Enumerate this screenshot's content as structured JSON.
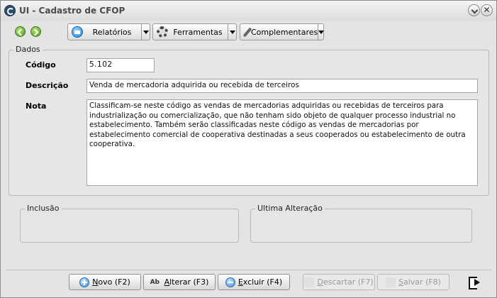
{
  "window": {
    "title": "UI - Cadastro de CFOP"
  },
  "toolbar": {
    "relatorios_label": "Relatórios",
    "ferramentas_label": "Ferramentas",
    "complementares_label": "Complementares"
  },
  "dados": {
    "group_title": "Dados",
    "codigo_label": "Código",
    "codigo_value": "5.102",
    "descricao_label": "Descrição",
    "descricao_value": "Venda de mercadoria adquirida ou recebida de terceiros",
    "nota_label": "Nota",
    "nota_value": "Classificam-se neste código as vendas de mercadorias adquiridas ou recebidas de terceiros para industrialização ou comercialização, que não tenham sido objeto de qualquer processo industrial no estabelecimento. Também serão classificadas neste código as vendas de mercadorias por estabelecimento comercial de cooperativa destinadas a seus cooperados ou estabelecimento de outra cooperativa."
  },
  "inclusao": {
    "title": "Inclusão"
  },
  "ultima_alteracao": {
    "title": "Ultima Alteração"
  },
  "actions": {
    "novo": {
      "underlined": "N",
      "rest": "ovo (F2)"
    },
    "alterar": {
      "underlined": "A",
      "rest": "lterar (F3)"
    },
    "excluir": {
      "underlined": "E",
      "rest": "xcluir (F4)"
    },
    "descartar": {
      "underlined": "D",
      "rest": "escartar (F7)"
    },
    "salvar": {
      "underlined": "S",
      "rest": "alvar (F8)"
    },
    "alterar_icon_text": "Ab"
  },
  "icons": {
    "app": "app-logo-icon",
    "back": "back-arrow-icon",
    "forward": "forward-arrow-icon",
    "relatorios": "printer-icon",
    "ferramentas": "gear-icon",
    "complementares": "paperclip-icon",
    "exit": "exit-door-icon"
  }
}
